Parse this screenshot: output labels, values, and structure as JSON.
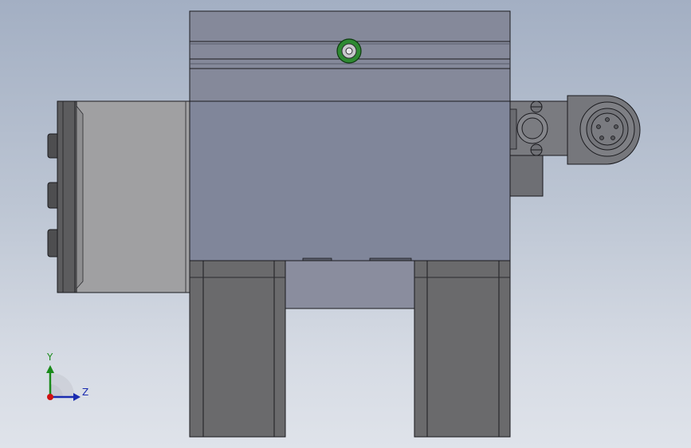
{
  "viewport": {
    "background_top": "#a3afc3",
    "background_bottom": "#dfe3ea"
  },
  "model": {
    "body_color": "#80869a",
    "left_block_color": "#a0a0a2",
    "left_flange_color": "#5c5c5e",
    "leg_color": "#6a6a6c",
    "connector_color": "#77787c",
    "screw_color": "#2e8a32",
    "edge_color": "#1a1a1e"
  },
  "triad": {
    "y_label": "Y",
    "z_label": "Z",
    "y_color": "#1a8a1a",
    "z_color": "#1a2bb0",
    "origin_color": "#d01010"
  }
}
